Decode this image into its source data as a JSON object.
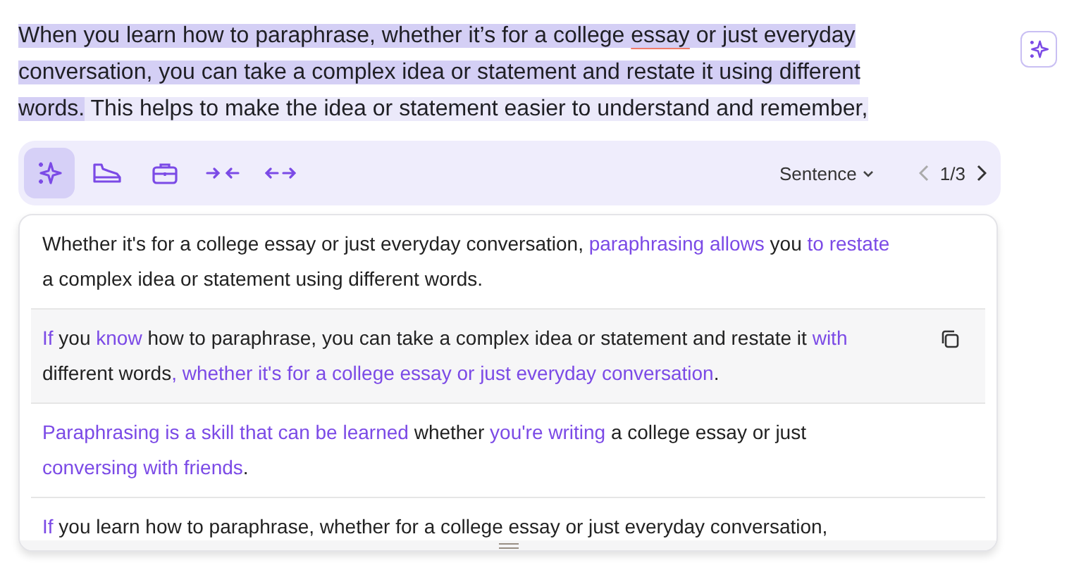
{
  "document": {
    "segments": [
      {
        "text": "When you learn how to paraphrase, whether it’s for a college ",
        "selected": true,
        "flagged": false
      },
      {
        "text": "essay",
        "selected": true,
        "flagged": true
      },
      {
        "text": " or just everyday conversation, you can take a complex idea or statement and restate it using different words.",
        "selected": true,
        "flagged": false
      },
      {
        "text": " This helps to make the idea or statement easier to understand and remember,",
        "selected": false,
        "flagged": false
      }
    ]
  },
  "toolbar": {
    "tools": [
      {
        "kind": "sparkle",
        "selected": true
      },
      {
        "kind": "shoe",
        "selected": false
      },
      {
        "kind": "briefcase",
        "selected": false
      },
      {
        "kind": "shorten",
        "selected": false
      },
      {
        "kind": "expand",
        "selected": false
      }
    ],
    "mode": "Sentence",
    "pager": "1/3"
  },
  "suggestions": [
    {
      "highlighted": false,
      "segments": [
        {
          "text": "Whether it's for a college essay or just everyday conversation, ",
          "changed": false
        },
        {
          "text": "paraphrasing allows",
          "changed": true
        },
        {
          "text": " you ",
          "changed": false
        },
        {
          "text": "to restate",
          "changed": true
        },
        {
          "text": " a complex idea or statement using different words.",
          "changed": false
        }
      ]
    },
    {
      "highlighted": true,
      "segments": [
        {
          "text": "If",
          "changed": true
        },
        {
          "text": " you ",
          "changed": false
        },
        {
          "text": "know",
          "changed": true
        },
        {
          "text": " how to paraphrase, you can take a complex idea or statement and restate it ",
          "changed": false
        },
        {
          "text": "with",
          "changed": true
        },
        {
          "text": " different words",
          "changed": false
        },
        {
          "text": ", whether it's for a college essay or just everyday conversation",
          "changed": true
        },
        {
          "text": ".",
          "changed": false
        }
      ]
    },
    {
      "highlighted": false,
      "segments": [
        {
          "text": "Paraphrasing is a skill that can be learned",
          "changed": true
        },
        {
          "text": " whether ",
          "changed": false
        },
        {
          "text": "you're writing",
          "changed": true
        },
        {
          "text": " a college essay or just ",
          "changed": false
        },
        {
          "text": "conversing with friends",
          "changed": true
        },
        {
          "text": ".",
          "changed": false
        }
      ]
    },
    {
      "highlighted": false,
      "segments": [
        {
          "text": "If",
          "changed": true
        },
        {
          "text": " you learn how to paraphrase, whether for a college essay or just everyday conversation,",
          "changed": false
        }
      ]
    }
  ]
}
